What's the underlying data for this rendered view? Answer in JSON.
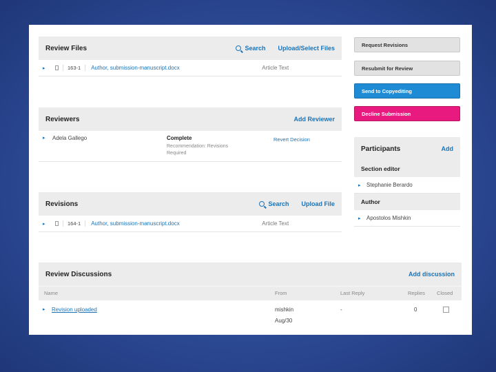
{
  "review_files": {
    "title": "Review Files",
    "search_label": "Search",
    "upload_label": "Upload/Select Files",
    "files": [
      {
        "id": "163-1",
        "name": "Author, submission-manuscript.docx",
        "type": "Article Text"
      }
    ]
  },
  "reviewers": {
    "title": "Reviewers",
    "add_label": "Add Reviewer",
    "rows": [
      {
        "name": "Adela Gallego",
        "status": "Complete",
        "recommendation_line1": "Recommendation: Revisions",
        "recommendation_line2": "Required",
        "action": "Revert Decision"
      }
    ]
  },
  "revisions": {
    "title": "Revisions",
    "search_label": "Search",
    "upload_label": "Upload File",
    "files": [
      {
        "id": "164-1",
        "name": "Author, submission-manuscript.docx",
        "type": "Article Text"
      }
    ]
  },
  "review_discussions": {
    "title": "Review Discussions",
    "add_label": "Add discussion",
    "columns": {
      "name": "Name",
      "from": "From",
      "last_reply": "Last Reply",
      "replies": "Replies",
      "closed": "Closed"
    },
    "rows": [
      {
        "name": "Revision uploaded",
        "from_user": "mishkin",
        "from_date": "Aug/30",
        "last_reply": "-",
        "replies": "0"
      }
    ]
  },
  "actions": {
    "request_revisions": "Request Revisions",
    "resubmit": "Resubmit for Review",
    "send_copyediting": "Send to Copyediting",
    "decline": "Decline Submission"
  },
  "participants": {
    "title": "Participants",
    "add_label": "Add",
    "groups": [
      {
        "role": "Section editor",
        "member": "Stephanie Berardo"
      },
      {
        "role": "Author",
        "member": "Apostolos Mishkin"
      }
    ]
  }
}
